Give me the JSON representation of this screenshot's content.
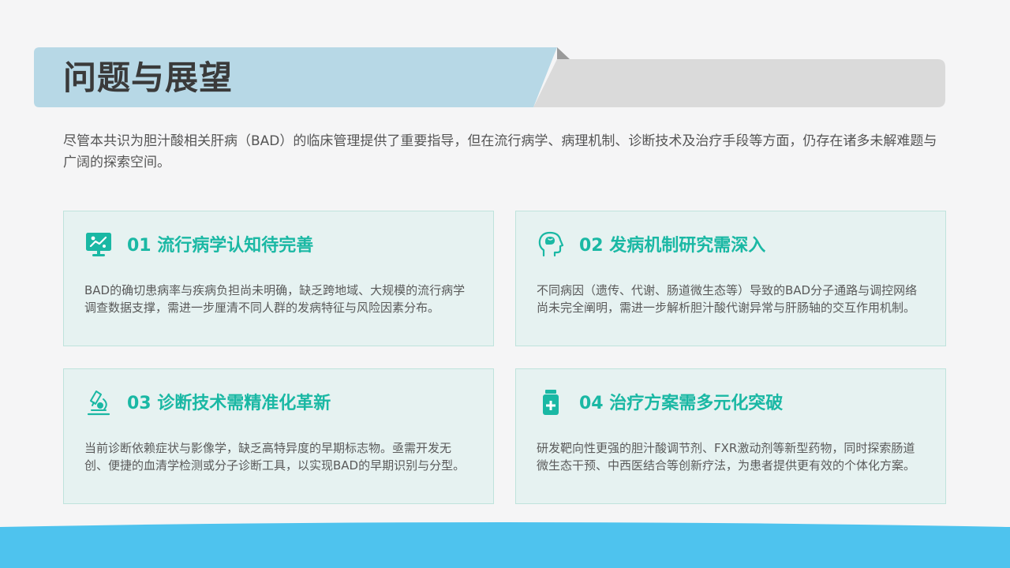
{
  "header": {
    "title": "问题与展望"
  },
  "intro": {
    "text": "尽管本共识为胆汁酸相关肝病（BAD）的临床管理提供了重要指导，但在流行病学、病理机制、诊断技术及治疗手段等方面，仍存在诸多未解难题与广阔的探索空间。"
  },
  "cards": [
    {
      "icon": "monitor-chart-icon",
      "title": "01 流行病学认知待完善",
      "text": "BAD的确切患病率与疾病负担尚未明确，缺乏跨地域、大规模的流行病学调查数据支撑，需进一步厘清不同人群的发病特征与风险因素分布。"
    },
    {
      "icon": "head-brain-icon",
      "title": "02 发病机制研究需深入",
      "text": "不同病因（遗传、代谢、肠道微生态等）导致的BAD分子通路与调控网络尚未完全阐明，需进一步解析胆汁酸代谢异常与肝肠轴的交互作用机制。"
    },
    {
      "icon": "microscope-icon",
      "title": "03 诊断技术需精准化革新",
      "text": "当前诊断依赖症状与影像学，缺乏高特异度的早期标志物。亟需开发无创、便捷的血清学检测或分子诊断工具，以实现BAD的早期识别与分型。"
    },
    {
      "icon": "medicine-bottle-icon",
      "title": "04 治疗方案需多元化突破",
      "text": "研发靶向性更强的胆汁酸调节剂、FXR激动剂等新型药物，同时探索肠道微生态干预、中西医结合等创新疗法，为患者提供更有效的个体化方案。"
    }
  ],
  "colors": {
    "accent": "#1ab8a4",
    "banner_blue": "#b7d8e6",
    "banner_gray": "#dadada",
    "card_bg": "#e6f2f1",
    "card_border": "#bfe3dc",
    "footer_blue": "#4ec3ee"
  }
}
